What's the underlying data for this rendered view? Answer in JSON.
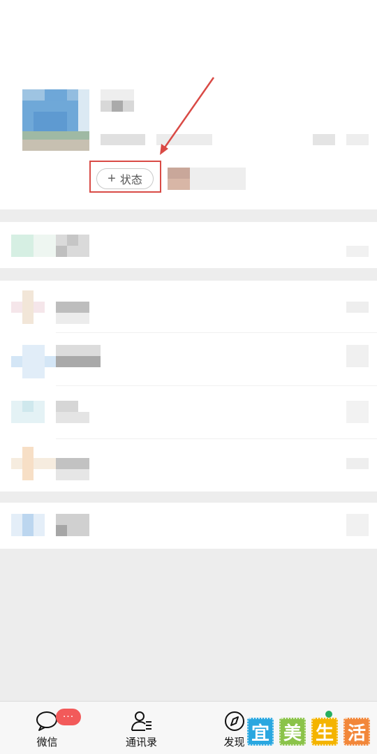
{
  "profile": {
    "status_button_label": "状态",
    "status_plus": "+"
  },
  "tabbar": {
    "tabs": [
      {
        "label": "微信",
        "icon": "chat-icon"
      },
      {
        "label": "通讯录",
        "icon": "contacts-icon"
      },
      {
        "label": "发现",
        "icon": "compass-icon"
      }
    ],
    "badge_text": "···"
  },
  "watermark": {
    "chars": [
      "宜",
      "美",
      "生",
      "活"
    ],
    "colors": [
      "#2aa7e0",
      "#8bc34a",
      "#f4b400",
      "#f2873a"
    ]
  },
  "colors": {
    "accent_red": "#d94a45",
    "badge_red": "#f25a5a",
    "background": "#ededed"
  }
}
